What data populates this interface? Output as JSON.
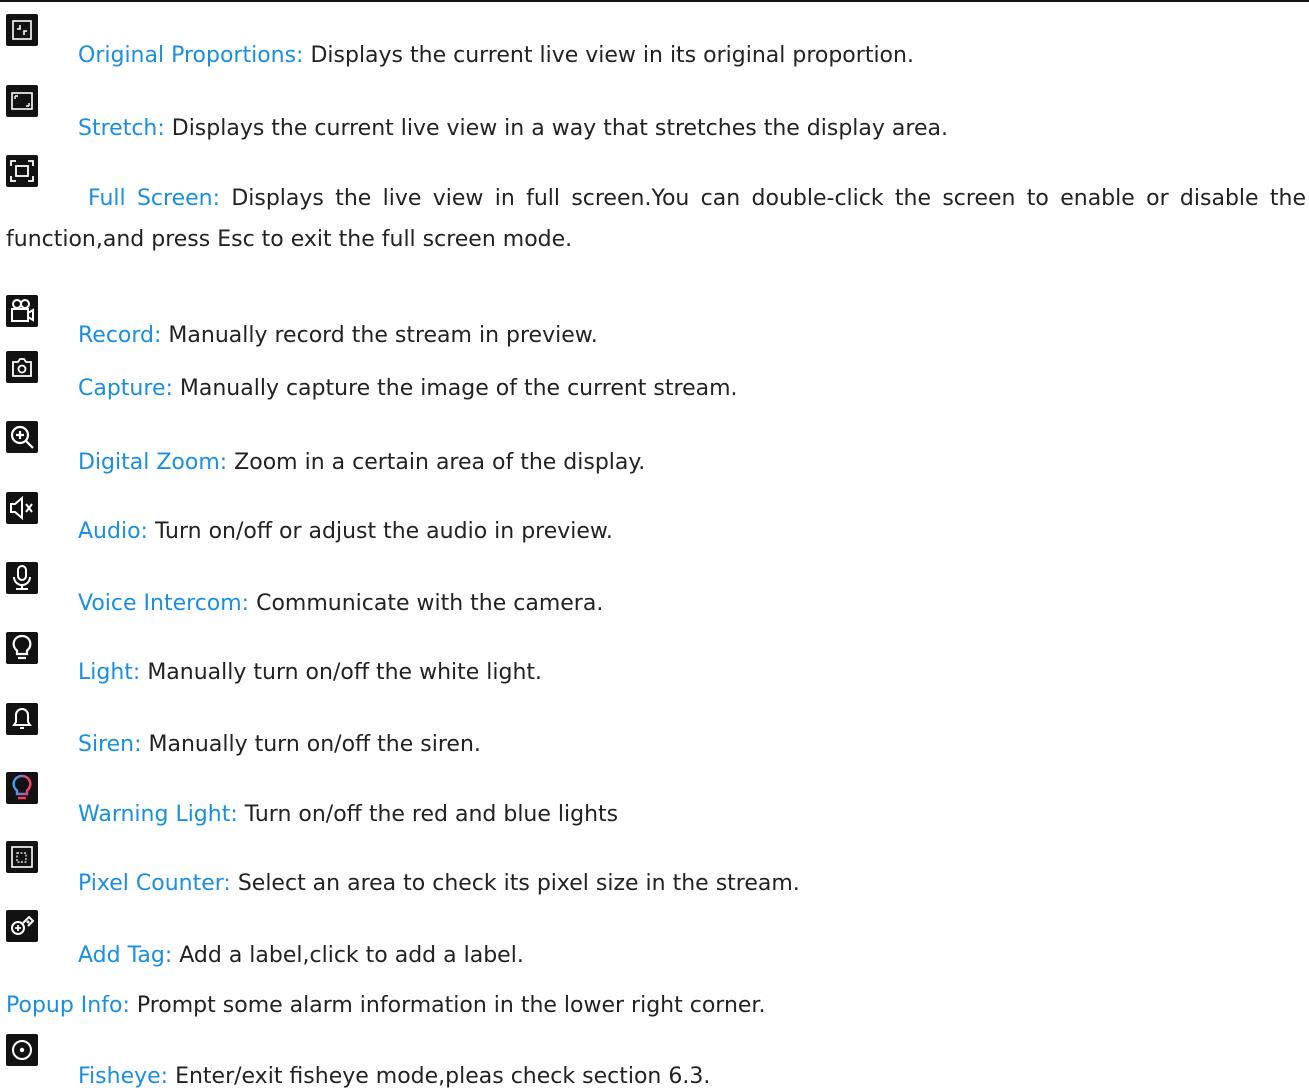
{
  "items": [
    {
      "icon": "original-proportions-icon",
      "term": "Original Proportions:",
      "desc": " Displays the current live view in its original proportion."
    },
    {
      "icon": "stretch-icon",
      "term": "Stretch:",
      "desc": " Displays the current live view in a way that stretches the display area."
    },
    {
      "icon": "full-screen-icon",
      "term": "Full Screen:",
      "desc": " Displays the live view in full screen.You can double-click the screen to enable or disable the function,and press Esc to exit the full screen mode."
    },
    {
      "icon": "record-icon",
      "term": "Record:",
      "desc": " Manually record the stream in preview."
    },
    {
      "icon": "capture-icon",
      "term": "Capture:",
      "desc": " Manually capture the image of the current stream."
    },
    {
      "icon": "digital-zoom-icon",
      "term": "Digital Zoom:",
      "desc": " Zoom in a certain area of the display."
    },
    {
      "icon": "audio-icon",
      "term": "Audio:",
      "desc": " Turn on/off or adjust the audio in preview."
    },
    {
      "icon": "voice-intercom-icon",
      "term": "Voice Intercom:",
      "desc": " Communicate with the camera."
    },
    {
      "icon": "light-icon",
      "term": "Light:",
      "desc": " Manually turn on/off the white light."
    },
    {
      "icon": "siren-icon",
      "term": "Siren:",
      "desc": " Manually turn on/off the siren."
    },
    {
      "icon": "warning-light-icon",
      "term": "Warning Light:",
      "desc": " Turn on/off the red and blue lights"
    },
    {
      "icon": "pixel-counter-icon",
      "term": "Pixel Counter:",
      "desc": " Select an area to check its pixel size in the stream."
    },
    {
      "icon": "add-tag-icon",
      "term": "Add Tag:",
      "desc": " Add a label,click to add a label."
    },
    {
      "icon": "",
      "term": "Popup Info:",
      "desc": " Prompt some alarm information in the lower right corner."
    },
    {
      "icon": "fisheye-icon",
      "term": "Fisheye:",
      "desc": " Enter/exit fisheye mode,pleas check section 6.3."
    }
  ],
  "colors": {
    "term": "#1a8fe0",
    "icon_bg": "#121212",
    "icon_fg": "#ffffff"
  }
}
